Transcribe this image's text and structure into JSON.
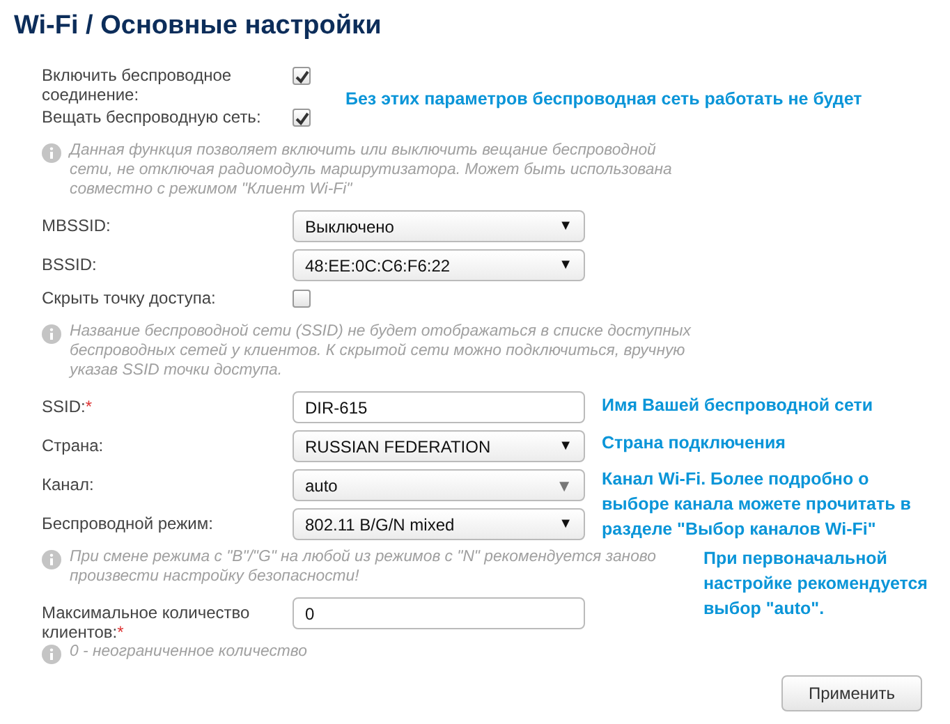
{
  "title": "Wi-Fi /  Основные настройки",
  "rows": [
    {
      "kind": "checkbox",
      "label": "Включить беспроводное соединение:",
      "checked": true
    },
    {
      "kind": "checkbox",
      "label": "Вещать беспроводную сеть:",
      "checked": true
    },
    {
      "kind": "hint",
      "text": "Данная функция позволяет включить или выключить вещание беспроводной сети, не отключая радиомодуль маршрутизатора. Может быть использована совместно с режимом \"Клиент Wi-Fi\""
    },
    {
      "kind": "select",
      "label": "MBSSID:",
      "value": "Выключено",
      "disabled": false,
      "arrow": "▼"
    },
    {
      "kind": "select",
      "label": "BSSID:",
      "value": "48:EE:0C:C6:F6:22",
      "disabled": false,
      "arrow": "▼"
    },
    {
      "kind": "checkbox",
      "label": "Скрыть точку доступа:",
      "checked": false
    },
    {
      "kind": "hint",
      "text": "Название беспроводной сети (SSID) не будет отображаться в списке доступных беспроводных сетей у клиентов. К скрытой сети можно подключиться, вручную указав SSID точки доступа."
    },
    {
      "kind": "input",
      "label": "SSID:",
      "required_mark": "*",
      "value": "DIR-615"
    },
    {
      "kind": "select",
      "label": "Страна:",
      "value": "RUSSIAN FEDERATION",
      "disabled": false,
      "arrow": "▼"
    },
    {
      "kind": "select",
      "label": "Канал:",
      "value": "auto",
      "disabled": true,
      "arrow": "▼"
    },
    {
      "kind": "select",
      "label": "Беспроводной режим:",
      "value": "802.11 B/G/N mixed",
      "disabled": false,
      "arrow": "▼"
    },
    {
      "kind": "hint",
      "text": "При смене режима с \"B\"/\"G\" на любой из режимов с \"N\" рекомендуется заново произвести настройку безопасности!"
    },
    {
      "kind": "input",
      "label": "Максимальное количество клиентов:",
      "required_mark": "*",
      "value": "0"
    },
    {
      "kind": "hint",
      "text": "0 - неограниченное количество"
    }
  ],
  "apply_button": "Применить",
  "annotations": [
    {
      "text": "Без этих параметров беспроводная сеть работать не будет"
    },
    {
      "text": "Имя Вашей беспроводной сети"
    },
    {
      "text": "Страна подключения"
    },
    {
      "text": "Канал Wi-Fi. Более подробно о выборе канала можете прочитать в разделе \"Выбор каналов Wi-Fi\""
    },
    {
      "text": "При первоначальной настройке рекомендуется выбор \"auto\"."
    }
  ]
}
